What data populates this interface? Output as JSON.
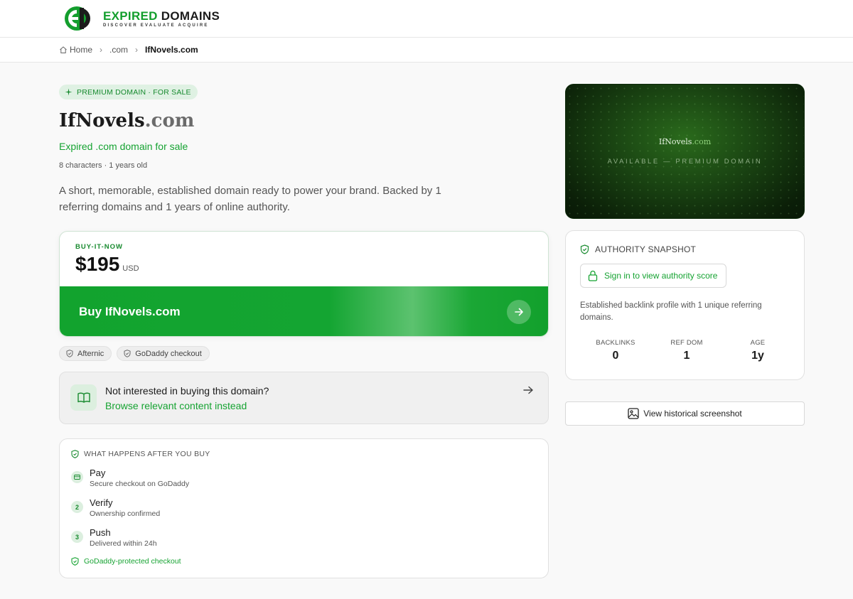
{
  "header": {
    "logo_word1": "EXPIRED",
    "logo_word2": "DOMAINS",
    "logo_tagline": "DISCOVER EVALUATE ACQUIRE"
  },
  "breadcrumb": {
    "home": "Home",
    "tld": ".com",
    "current": "IfNovels.com"
  },
  "hero": {
    "badge": "PREMIUM DOMAIN · FOR SALE",
    "name": "IfNovels",
    "tld": ".com",
    "subtitle": "Expired .com domain for sale",
    "meta": "8 characters · 1 years old",
    "description": "A short, memorable, established domain ready to power your brand. Backed by 1 referring domains and 1 years of online authority."
  },
  "purchase": {
    "label": "BUY-IT-NOW",
    "price": "$195",
    "currency": "USD",
    "button_label": "Buy IfNovels.com",
    "marketplaces": [
      "Afternic",
      "GoDaddy checkout"
    ]
  },
  "browse": {
    "question": "Not interested in buying this domain?",
    "link": "Browse relevant content instead"
  },
  "steps": {
    "header": "WHAT HAPPENS AFTER YOU BUY",
    "items": [
      {
        "marker": "",
        "title": "Pay",
        "detail": "Secure checkout on GoDaddy"
      },
      {
        "marker": "2",
        "title": "Verify",
        "detail": "Ownership confirmed"
      },
      {
        "marker": "3",
        "title": "Push",
        "detail": "Delivered within 24h"
      }
    ],
    "footer": "GoDaddy-protected checkout"
  },
  "preview_card": {
    "name": "IfNovels",
    "tld": ".com",
    "tagline": "AVAILABLE — PREMIUM DOMAIN"
  },
  "authority": {
    "header": "AUTHORITY SNAPSHOT",
    "signin_label": "Sign in to view authority score",
    "blurb": "Established backlink profile with 1 unique referring domains.",
    "stats": [
      {
        "label": "BACKLINKS",
        "value": "0"
      },
      {
        "label": "REF DOM",
        "value": "1"
      },
      {
        "label": "AGE",
        "value": "1y"
      }
    ]
  },
  "history": {
    "button_label": "View historical screenshot"
  },
  "colors": {
    "brand_green": "#16a332",
    "badge_bg": "#dff1e3"
  }
}
